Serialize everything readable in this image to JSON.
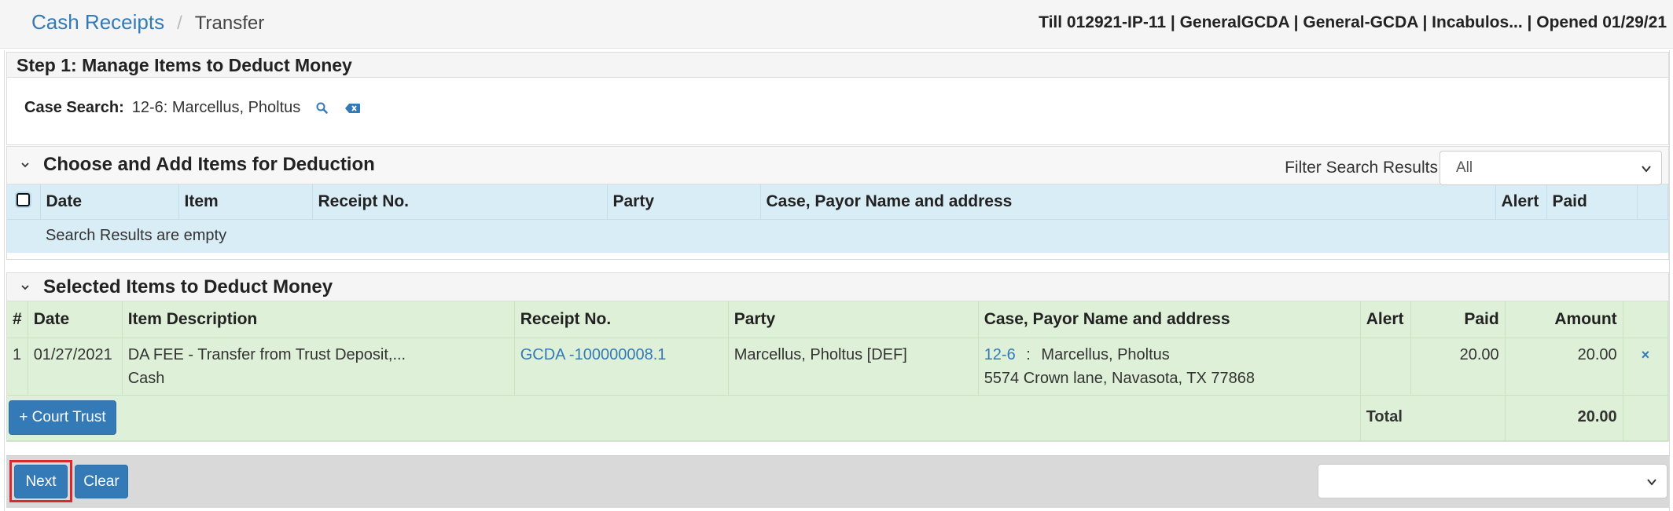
{
  "breadcrumb": {
    "root": "Cash Receipts",
    "separator": "/",
    "current": "Transfer"
  },
  "till_info": "Till 012921-IP-11 | GeneralGCDA | General-GCDA | Incabulos... | Opened 01/29/21",
  "step1": {
    "title": "Step 1: Manage Items to Deduct Money",
    "case_search_label": "Case Search:",
    "case_search_value": "12-6: Marcellus, Pholtus"
  },
  "choose_section": {
    "title": "Choose and Add Items for Deduction",
    "filter_label": "Filter Search Results",
    "filter_value": "All",
    "columns": [
      "Date",
      "Item",
      "Receipt No.",
      "Party",
      "Case, Payor Name and address",
      "Alert",
      "Paid"
    ],
    "empty_message": "Search Results are empty"
  },
  "selected_section": {
    "title": "Selected Items to Deduct Money",
    "columns": [
      "#",
      "Date",
      "Item Description",
      "Receipt No.",
      "Party",
      "Case, Payor Name and address",
      "Alert",
      "Paid",
      "Amount"
    ],
    "rows": [
      {
        "num": "1",
        "date": "01/27/2021",
        "desc_line1": "DA FEE - Transfer from Trust Deposit,...",
        "desc_line2": "Cash",
        "receipt": "GCDA -100000008.1",
        "party": "Marcellus, Pholtus [DEF]",
        "case_link": "12-6",
        "case_sep": ":",
        "payor_name": "Marcellus, Pholtus",
        "payor_address": "5574 Crown lane, Navasota, TX 77868",
        "alert": "",
        "paid": "20.00",
        "amount": "20.00",
        "remove": "×"
      }
    ],
    "court_trust_button": "+ Court Trust",
    "total_label": "Total",
    "total_amount": "20.00"
  },
  "footer": {
    "next_label": "Next",
    "clear_label": "Clear",
    "select_value": ""
  },
  "colors": {
    "primary": "#337ab7",
    "info_row": "#d9edf7",
    "success_row": "#dff0d8",
    "highlight_border": "#d9292f"
  }
}
